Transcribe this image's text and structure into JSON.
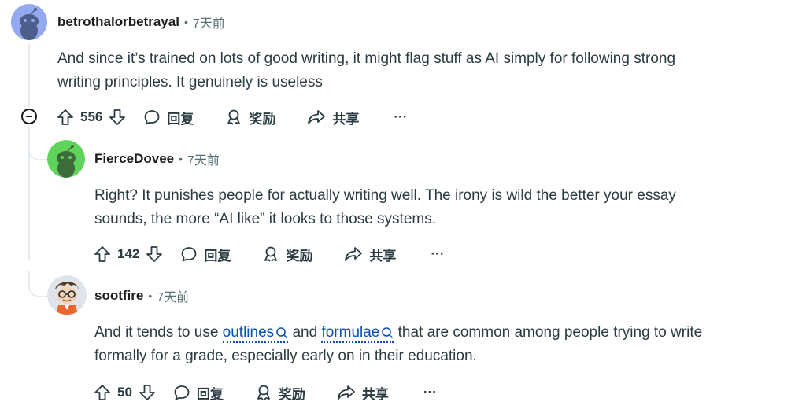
{
  "comments": [
    {
      "username": "betrothalorbetrayal",
      "separator": "•",
      "time": "7天前",
      "body_lines": [
        "And since it’s trained on lots of good writing, it might flag stuff as AI simply for following strong",
        "writing principles. It genuinely is useless"
      ],
      "votes": "556",
      "reply_label": "回复",
      "award_label": "奖励",
      "share_label": "共享",
      "more_label": "···"
    },
    {
      "username": "FierceDovee",
      "separator": "•",
      "time": "7天前",
      "body_lines": [
        "Right? It punishes people for actually writing well. The irony is wild the better your essay",
        "sounds, the more “AI like” it looks to those systems."
      ],
      "votes": "142",
      "reply_label": "回复",
      "award_label": "奖励",
      "share_label": "共享",
      "more_label": "···"
    },
    {
      "username": "sootfire",
      "separator": "•",
      "time": "7天前",
      "body_line1_pre": "And it tends to use ",
      "keyword1": "outlines",
      "body_line1_mid": " and ",
      "keyword2": "formulae",
      "body_line1_post": " that are common among people trying to write",
      "body_line2": "formally for a grade, especially early on in their education.",
      "votes": "50",
      "reply_label": "回复",
      "award_label": "奖励",
      "share_label": "共享",
      "more_label": "···"
    }
  ],
  "colors": {
    "link": "#0a4fb5",
    "text": "#2a3c42",
    "meta": "#576f76",
    "thread_line": "#e5ebee"
  }
}
